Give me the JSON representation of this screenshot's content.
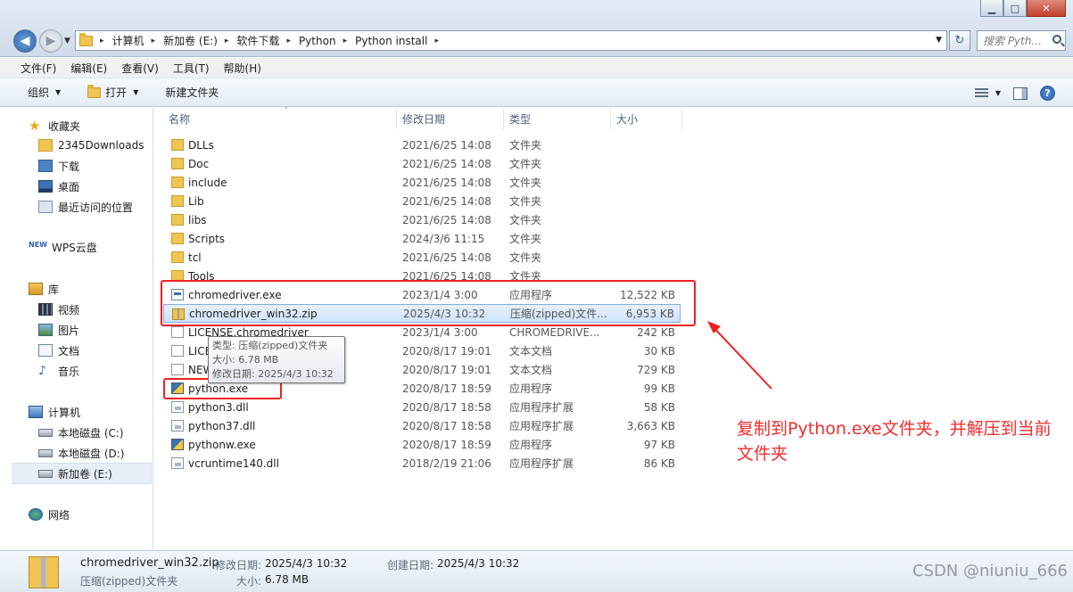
{
  "window": {
    "controls": {
      "minimize": "▁",
      "maximize": "□",
      "close": "✕"
    }
  },
  "nav": {
    "back": "◀",
    "forward": "▶",
    "dropdown": "▼"
  },
  "address": {
    "crumbs": [
      "计算机",
      "新加卷 (E:)",
      "软件下载",
      "Python",
      "Python install"
    ],
    "sep": "▸",
    "dropdown": "▼",
    "refresh": "↻"
  },
  "search": {
    "placeholder": "搜索 Pyth..."
  },
  "menubar": [
    "文件(F)",
    "编辑(E)",
    "查看(V)",
    "工具(T)",
    "帮助(H)"
  ],
  "toolbar": {
    "organize": "组织",
    "open": "打开",
    "new_folder": "新建文件夹",
    "help": "?",
    "arrow": "▼"
  },
  "sidebar": {
    "favorites": "收藏夹",
    "fav_items": [
      "2345Downloads",
      "下载",
      "桌面",
      "最近访问的位置"
    ],
    "wps": "WPS云盘",
    "wps_badge": "NEW",
    "library": "库",
    "lib_items": [
      "视频",
      "图片",
      "文档",
      "音乐"
    ],
    "computer": "计算机",
    "drives": [
      "本地磁盘 (C:)",
      "本地磁盘 (D:)",
      "新加卷 (E:)"
    ],
    "network": "网络"
  },
  "columns": {
    "name": "名称",
    "date": "修改日期",
    "type": "类型",
    "size": "大小",
    "sort": "˄"
  },
  "files": [
    {
      "name": "DLLs",
      "date": "2021/6/25 14:08",
      "type": "文件夹",
      "size": "",
      "icon": "folder"
    },
    {
      "name": "Doc",
      "date": "2021/6/25 14:08",
      "type": "文件夹",
      "size": "",
      "icon": "folder"
    },
    {
      "name": "include",
      "date": "2021/6/25 14:08",
      "type": "文件夹",
      "size": "",
      "icon": "folder"
    },
    {
      "name": "Lib",
      "date": "2021/6/25 14:08",
      "type": "文件夹",
      "size": "",
      "icon": "folder"
    },
    {
      "name": "libs",
      "date": "2021/6/25 14:08",
      "type": "文件夹",
      "size": "",
      "icon": "folder"
    },
    {
      "name": "Scripts",
      "date": "2024/3/6 11:15",
      "type": "文件夹",
      "size": "",
      "icon": "folder"
    },
    {
      "name": "tcl",
      "date": "2021/6/25 14:08",
      "type": "文件夹",
      "size": "",
      "icon": "folder"
    },
    {
      "name": "Tools",
      "date": "2021/6/25 14:08",
      "type": "文件夹",
      "size": "",
      "icon": "folder"
    },
    {
      "name": "chromedriver.exe",
      "date": "2023/1/4 3:00",
      "type": "应用程序",
      "size": "12,522 KB",
      "icon": "exe"
    },
    {
      "name": "chromedriver_win32.zip",
      "date": "2025/4/3 10:32",
      "type": "压缩(zipped)文件...",
      "size": "6,953 KB",
      "icon": "zip"
    },
    {
      "name": "LICENSE.chromedriver",
      "date": "2023/1/4 3:00",
      "type": "CHROMEDRIVE...",
      "size": "242 KB",
      "icon": "file"
    },
    {
      "name": "LICENSE.txt",
      "date": "2020/8/17 19:01",
      "type": "文本文档",
      "size": "30 KB",
      "icon": "file"
    },
    {
      "name": "NEWS.txt",
      "date": "2020/8/17 19:01",
      "type": "文本文档",
      "size": "729 KB",
      "icon": "file"
    },
    {
      "name": "python.exe",
      "date": "2020/8/17 18:59",
      "type": "应用程序",
      "size": "99 KB",
      "icon": "py"
    },
    {
      "name": "python3.dll",
      "date": "2020/8/17 18:58",
      "type": "应用程序扩展",
      "size": "58 KB",
      "icon": "dll"
    },
    {
      "name": "python37.dll",
      "date": "2020/8/17 18:58",
      "type": "应用程序扩展",
      "size": "3,663 KB",
      "icon": "dll"
    },
    {
      "name": "pythonw.exe",
      "date": "2020/8/17 18:59",
      "type": "应用程序",
      "size": "97 KB",
      "icon": "py"
    },
    {
      "name": "vcruntime140.dll",
      "date": "2018/2/19 21:06",
      "type": "应用程序扩展",
      "size": "86 KB",
      "icon": "dll"
    }
  ],
  "tooltip": [
    "类型: 压缩(zipped)文件夹",
    "大小: 6.78 MB",
    "修改日期: 2025/4/3 10:32"
  ],
  "annotation": "复制到Python.exe文件夹，并解压到当前文件夹",
  "details": {
    "name": "chromedriver_win32.zip",
    "type": "压缩(zipped)文件夹",
    "modified_label": "修改日期:",
    "modified": "2025/4/3 10:32",
    "created_label": "创建日期:",
    "created": "2025/4/3 10:32",
    "size_label": "大小:",
    "size": "6.78 MB"
  },
  "watermark": "CSDN @niuniu_666",
  "colors": {
    "annotation": "#f02020",
    "selection": "#cfe3fa"
  }
}
